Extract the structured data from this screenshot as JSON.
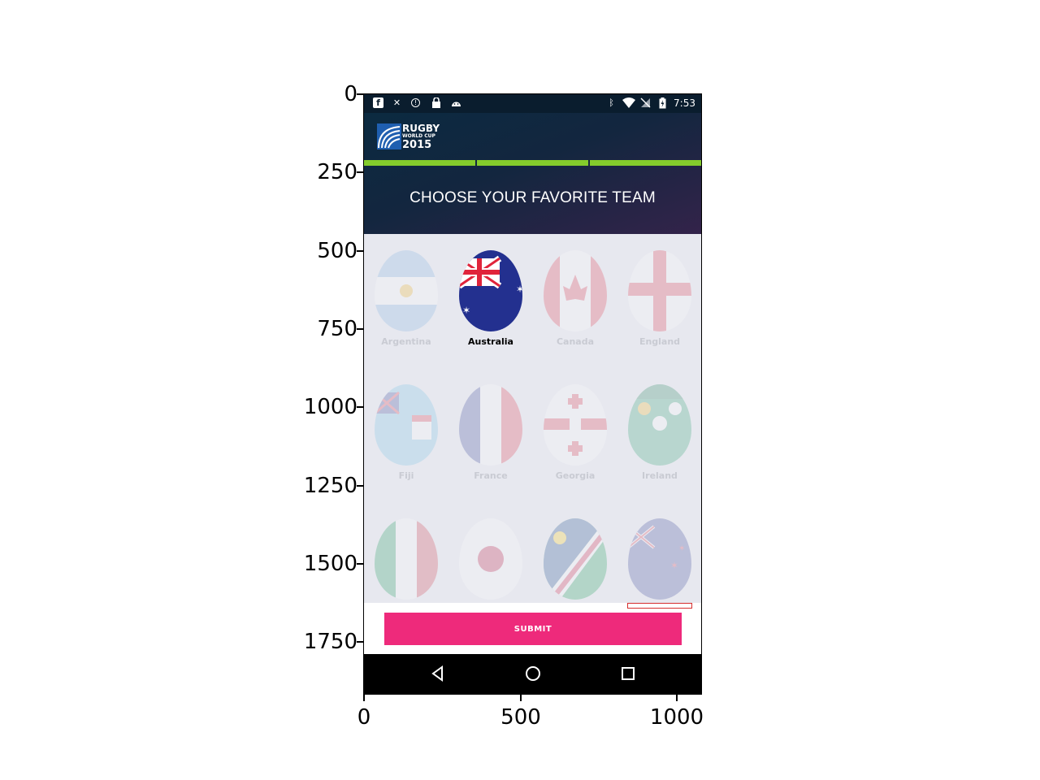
{
  "axes": {
    "y_ticks": [
      "0",
      "250",
      "500",
      "750",
      "1000",
      "1250",
      "1500",
      "1750"
    ],
    "x_ticks": [
      "0",
      "500",
      "1000"
    ]
  },
  "status_bar": {
    "time": "7:53",
    "left_icons": [
      "facebook-icon",
      "tools-icon",
      "info-icon",
      "lock-icon",
      "android-icon"
    ],
    "right_icons": [
      "bluetooth-icon",
      "wifi-icon",
      "no-sim-icon",
      "battery-icon"
    ]
  },
  "header": {
    "logo": {
      "line1": "RUGBY",
      "line2": "WORLD CUP",
      "line3": "2015"
    },
    "progress_segments": 3,
    "title": "CHOOSE YOUR FAVORITE TEAM"
  },
  "teams": [
    {
      "name": "Argentina",
      "selected": false
    },
    {
      "name": "Australia",
      "selected": true
    },
    {
      "name": "Canada",
      "selected": false
    },
    {
      "name": "England",
      "selected": false
    },
    {
      "name": "Fiji",
      "selected": false
    },
    {
      "name": "France",
      "selected": false
    },
    {
      "name": "Georgia",
      "selected": false
    },
    {
      "name": "Ireland",
      "selected": false
    },
    {
      "name": "",
      "selected": false
    },
    {
      "name": "",
      "selected": false
    },
    {
      "name": "",
      "selected": false
    },
    {
      "name": "",
      "selected": false
    }
  ],
  "bottom": {
    "submit_label": "SUBMIT"
  },
  "nav": [
    "back-icon",
    "home-icon",
    "recents-icon"
  ],
  "colors": {
    "accent": "#ee2a7b",
    "progress": "#84cc2c",
    "header_dark": "#13263f"
  }
}
